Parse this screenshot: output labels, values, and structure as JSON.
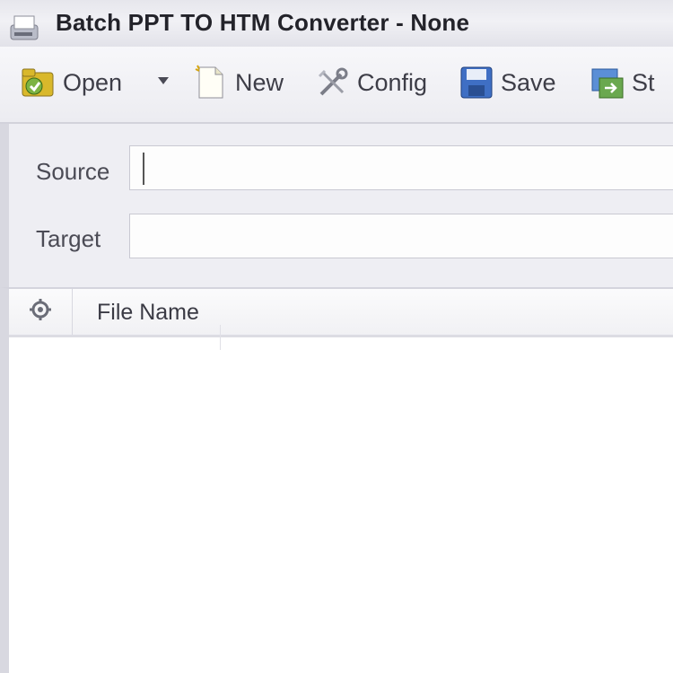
{
  "window": {
    "title": "Batch PPT TO HTM Converter - None"
  },
  "toolbar": {
    "open_label": "Open",
    "new_label": "New",
    "config_label": "Config",
    "save_label": "Save",
    "start_label": "St"
  },
  "form": {
    "source_label": "Source",
    "source_value": "",
    "target_label": "Target",
    "target_value": ""
  },
  "file_list": {
    "columns": [
      "",
      "File Name"
    ],
    "rows": []
  },
  "colors": {
    "window_bg": "#f3f3f6",
    "list_bg": "#ffffff",
    "open_icon": "#7cb342",
    "save_icon": "#3f6fc4"
  }
}
